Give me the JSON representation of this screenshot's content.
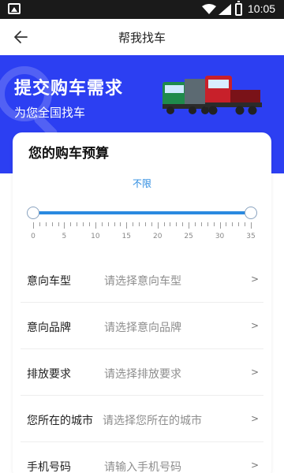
{
  "status_bar": {
    "time": "10:05"
  },
  "header": {
    "title": "帮我找车"
  },
  "banner": {
    "title": "提交购车需求",
    "subtitle": "为您全国找车"
  },
  "budget": {
    "title": "您的购车预算",
    "value_text": "不限",
    "range": {
      "min": 0,
      "max": 35,
      "low": 0,
      "high": 35
    },
    "tick_labels": [
      "0",
      "5",
      "10",
      "15",
      "20",
      "25",
      "30",
      "35"
    ]
  },
  "form": {
    "rows": [
      {
        "label": "意向车型",
        "placeholder": "请选择意向车型",
        "chevron": ">"
      },
      {
        "label": "意向品牌",
        "placeholder": "请选择意向品牌",
        "chevron": ">"
      },
      {
        "label": "排放要求",
        "placeholder": "请选择排放要求",
        "chevron": ">"
      },
      {
        "label": "您所在的城市",
        "placeholder": "请选择您所在的城市",
        "chevron": ">"
      },
      {
        "label": "手机号码",
        "placeholder": "请输入手机号码",
        "chevron": ">"
      }
    ]
  },
  "colors": {
    "banner": "#2c3ff2",
    "accent": "#2a8ae0"
  }
}
